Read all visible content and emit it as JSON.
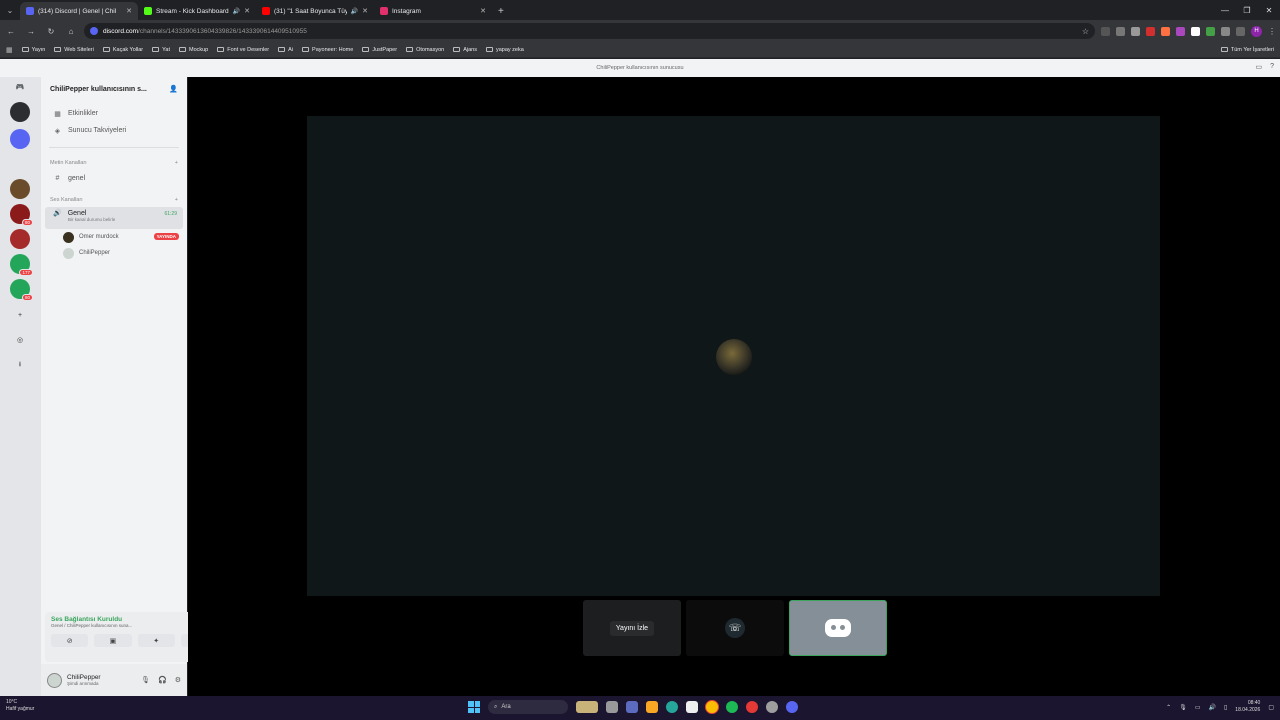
{
  "browser": {
    "tabs": [
      {
        "title": "(314) Discord | Genel | Chil",
        "color": "#5865f2",
        "active": true,
        "audio": false
      },
      {
        "title": "Stream - Kick Dashboard",
        "color": "#53fc18",
        "active": false,
        "audio": true
      },
      {
        "title": "(31) \"1 Saat Boyunca Tüyk",
        "color": "#ff0000",
        "active": false,
        "audio": true
      },
      {
        "title": "Instagram",
        "color": "#e1306c",
        "active": false,
        "audio": false
      }
    ],
    "new_tab_icon": "+",
    "url_host": "discord.com",
    "url_path": "/channels/1433390613604339826/1433390614409510955",
    "bookmarks": [
      "Yayın",
      "Web Siteleri",
      "Kaçak Yollar",
      "Yat",
      "Mockup",
      "Font ve Desenler",
      "Ai",
      "Payoneer: Home",
      "JustPaper",
      "Otomasyon",
      "Ajans",
      "yapay zeka"
    ],
    "bookmarks_right": "Tüm Yer İşaretleri",
    "profile_initial": "H"
  },
  "discord": {
    "window_title": "ChiliPepper kullanıcısının sunucusu",
    "server_name": "ChiliPepper kullanıcısının s...",
    "top_items": [
      {
        "label": "Etkinlikler",
        "icon": "▦"
      },
      {
        "label": "Sunucu Takviyeleri",
        "icon": "◈"
      }
    ],
    "text_category": "Metin Kanalları",
    "text_channel": "genel",
    "voice_category": "Ses Kanalları",
    "voice_channel": "Genel",
    "voice_time": "61:29",
    "voice_status": "Bir kanal durumu belirle",
    "voice_users": [
      {
        "name": "Omer murdock",
        "live": "YAYINDA",
        "color": "#3a3020"
      },
      {
        "name": "ChiliPepper",
        "live": "",
        "color": "#cdd5d0"
      }
    ],
    "guild_badges": [
      "",
      "",
      "",
      "",
      "",
      "80",
      "",
      "177",
      "80"
    ],
    "connection": {
      "status": "Ses Bağlantısı Kuruldu",
      "detail": "Genel / ChiliPepper kullanıcısının suna..."
    },
    "user": {
      "name": "ChiliPepper",
      "status": "Şimdi arınmada"
    },
    "watch_label": "Yayını İzle"
  },
  "taskbar": {
    "weather_temp": "10°C",
    "weather_desc": "Hafif yağmur",
    "search_placeholder": "Ara",
    "time": "08:40",
    "date": "18.04.2026"
  }
}
